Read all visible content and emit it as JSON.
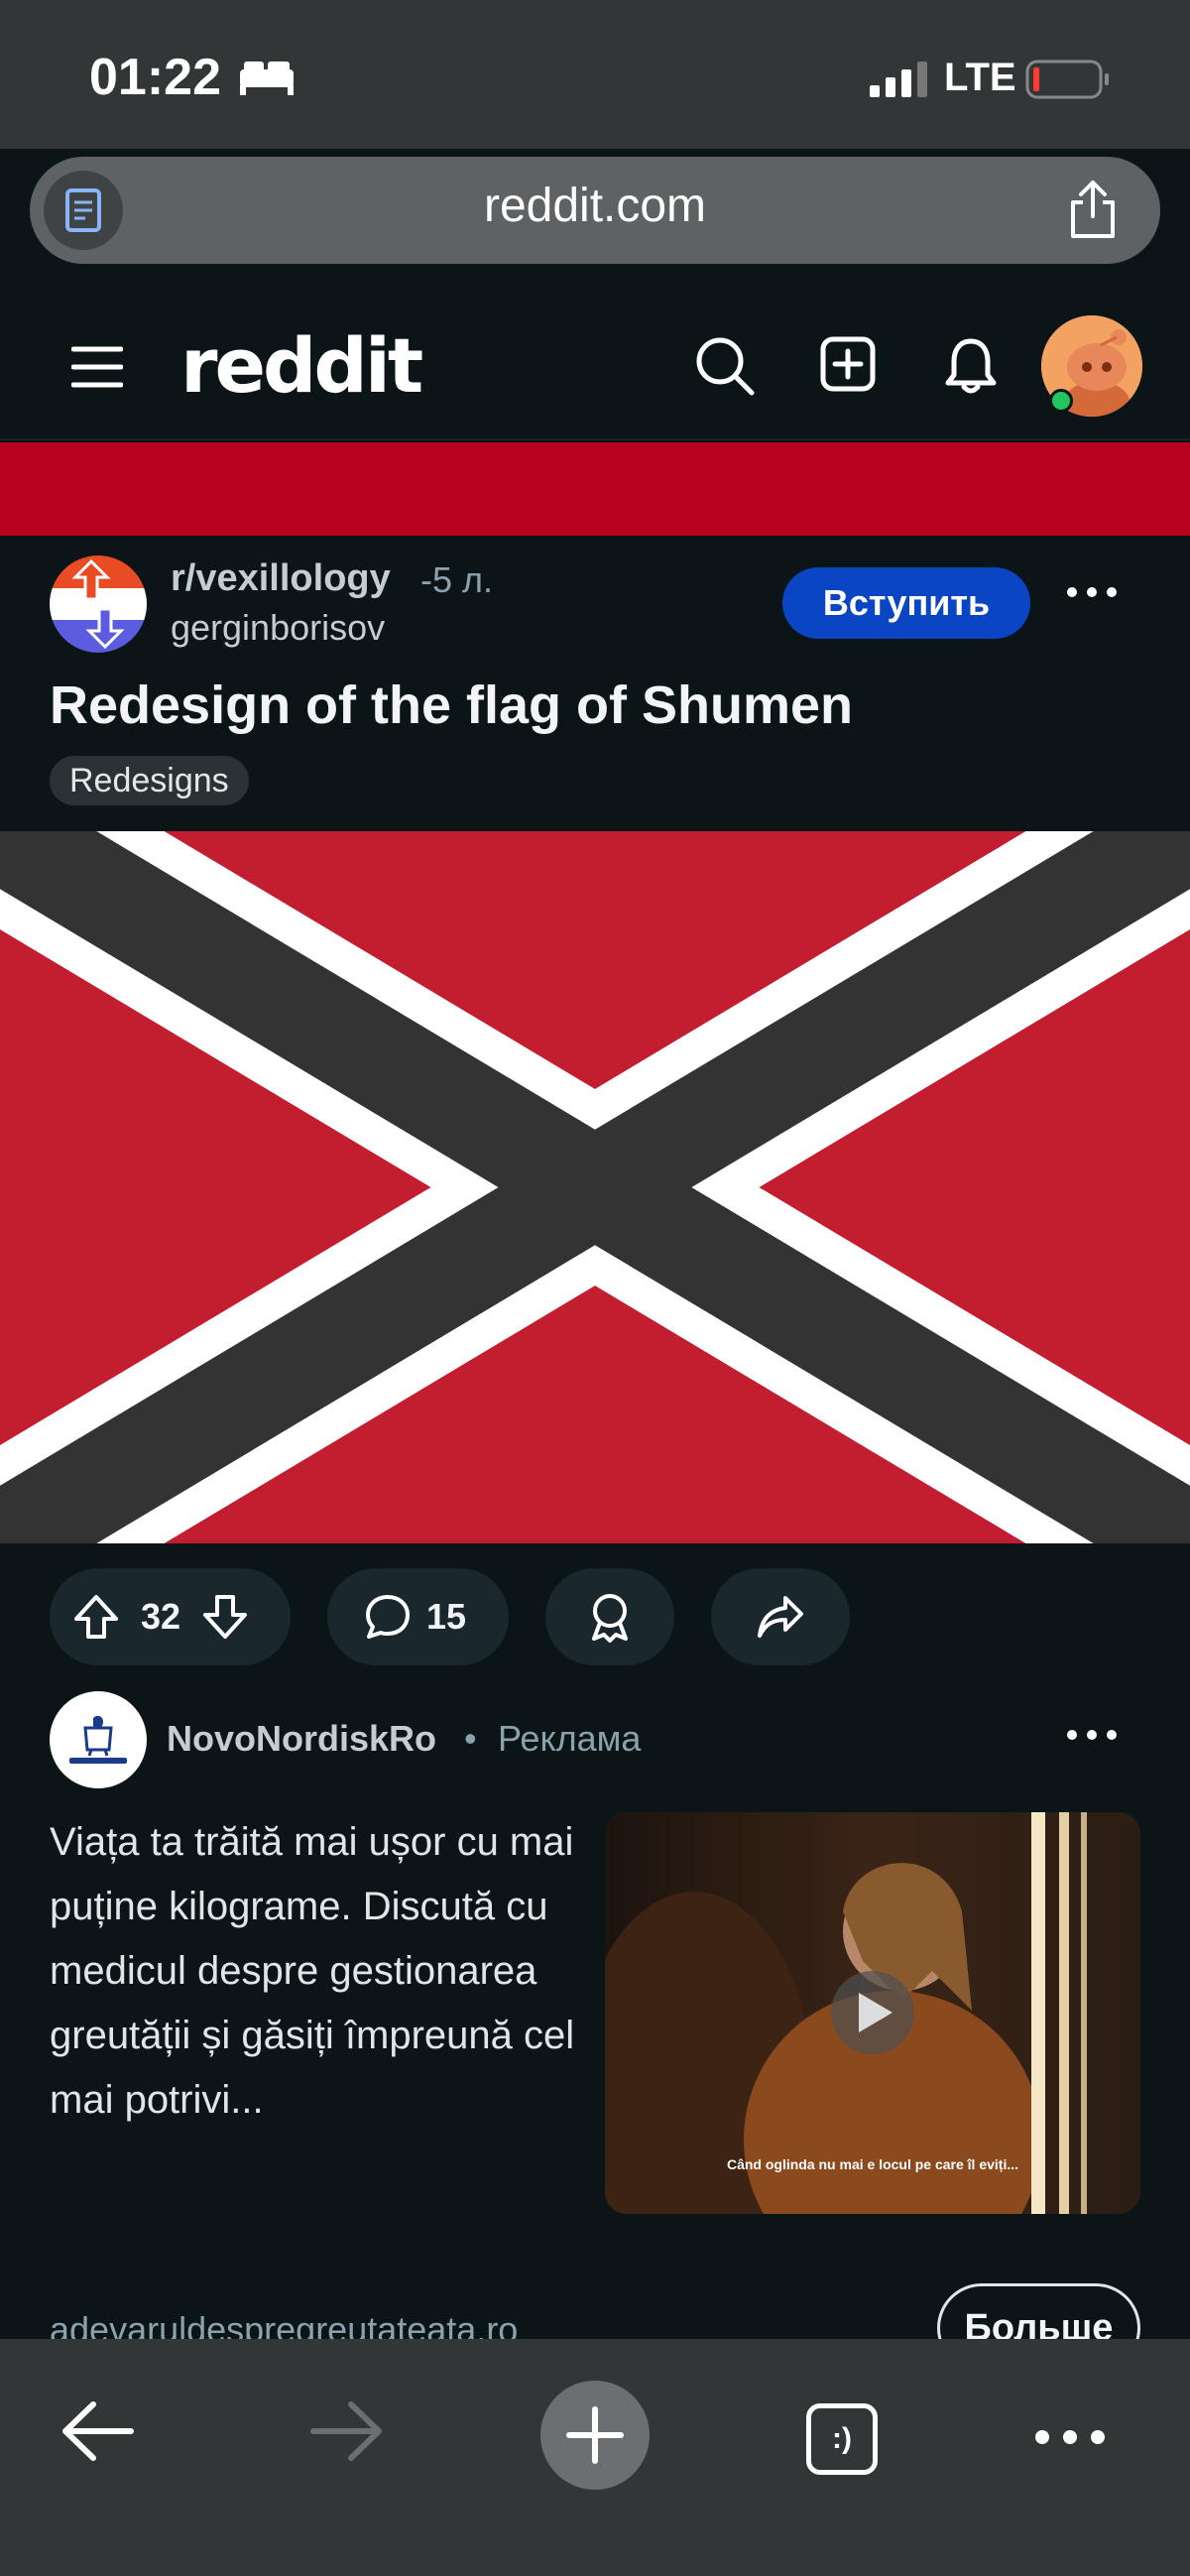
{
  "status_bar": {
    "time": "01:22",
    "network": "LTE"
  },
  "browser": {
    "url": "reddit.com"
  },
  "header": {
    "logo": "reddit"
  },
  "post": {
    "subreddit": "r/vexillology",
    "age": "-5 л.",
    "author": "gerginborisov",
    "join_label": "Вступить",
    "title": "Redesign of the flag of Shumen",
    "flair": "Redesigns",
    "upvotes": "32",
    "comments": "15"
  },
  "ad": {
    "advertiser": "NovoNordiskRo",
    "separator": "•",
    "label": "Реклама",
    "text": "Viața ta trăită mai ușor cu mai puține kilograme. Discută cu medicul despre gestionarea greutății și găsiți împreună cel mai potrivi...",
    "video_caption": "Când oglinda nu mai e locul pe care îl eviți...",
    "url": "adevaruldespregreutateata.ro",
    "cta_label": "Больше"
  },
  "colors": {
    "flag_red": "#c21e2f",
    "flag_black": "#333333",
    "join_blue": "#0a45c4",
    "banner_red": "#b8001f"
  }
}
